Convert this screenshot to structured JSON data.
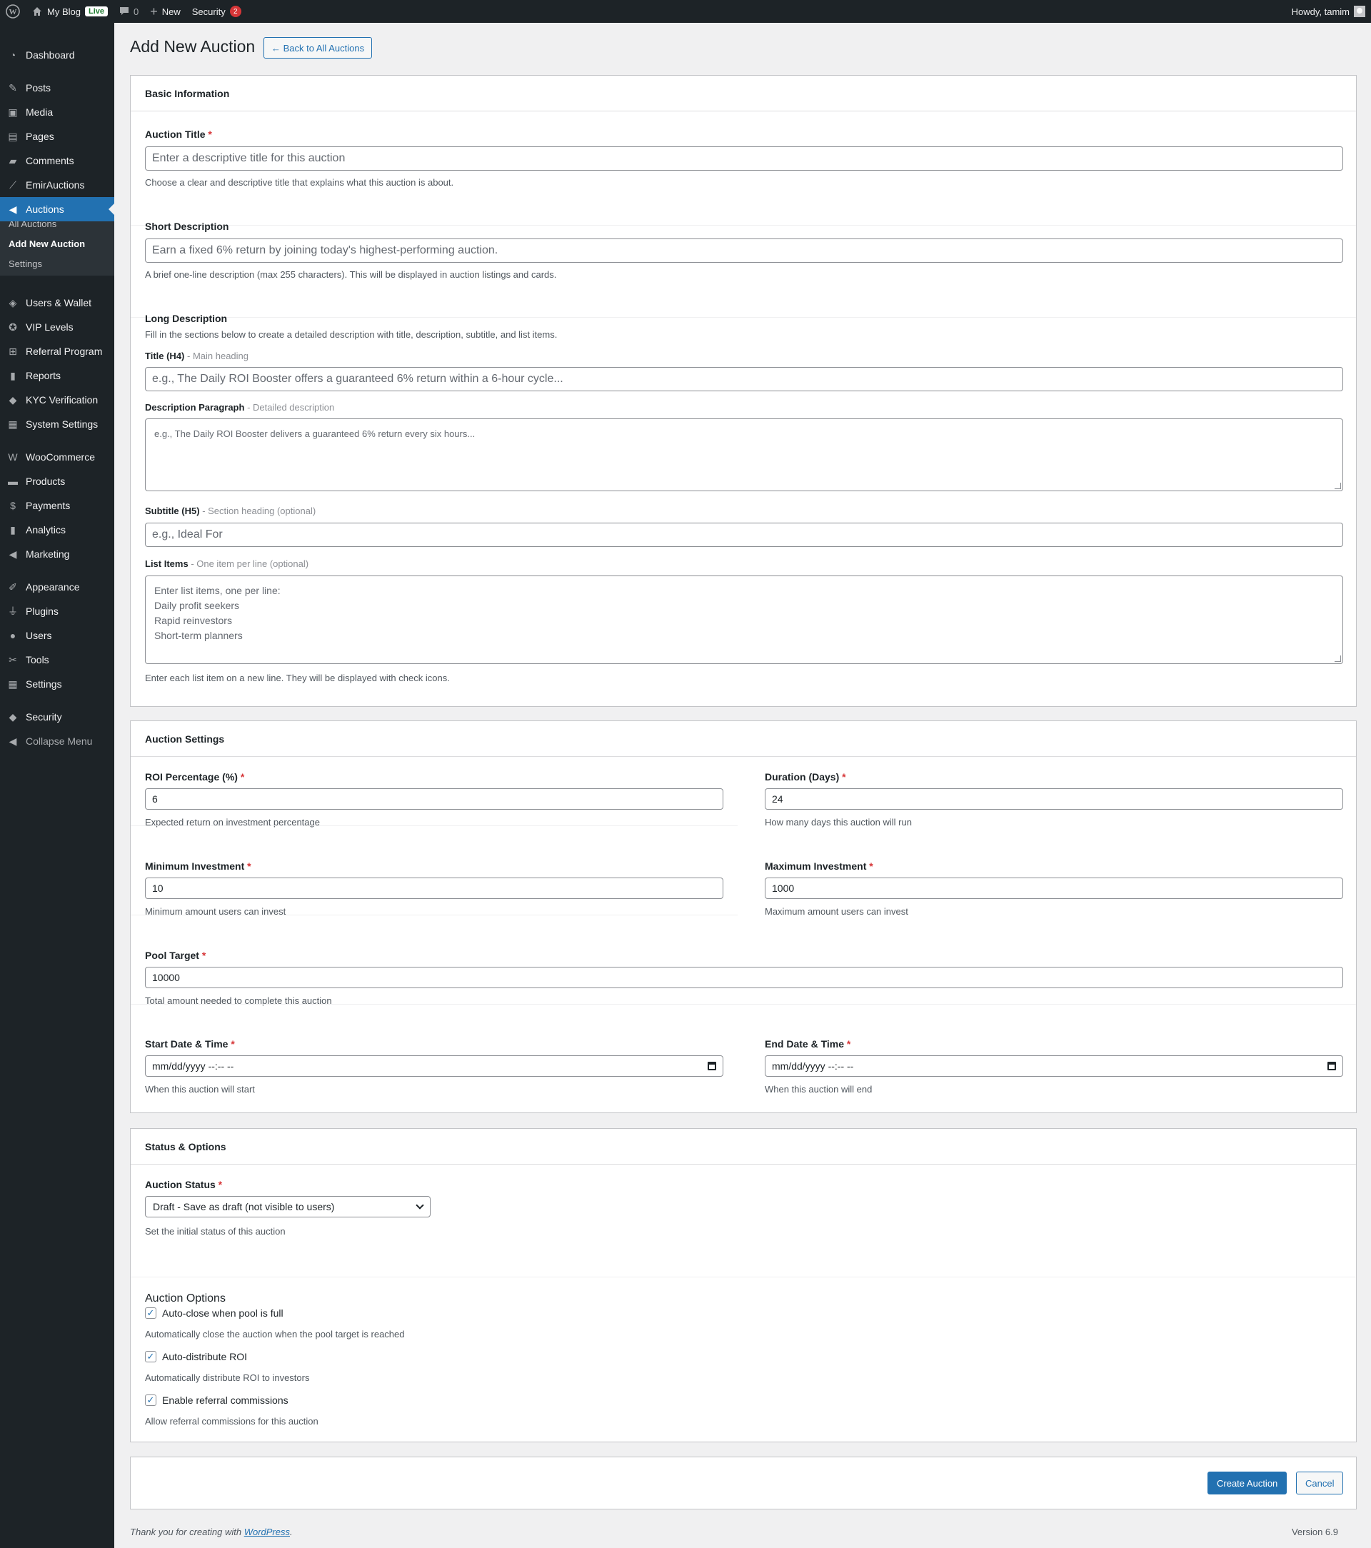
{
  "adminbar": {
    "site_name": "My Blog",
    "live_badge": "Live",
    "comments_count": "0",
    "new_label": "New",
    "security_label": "Security",
    "security_count": "2",
    "howdy": "Howdy, tamim"
  },
  "sidebar": {
    "items": [
      {
        "label": "Dashboard",
        "icon": "dashboard-icon"
      },
      {
        "label": "Posts",
        "icon": "pin-icon"
      },
      {
        "label": "Media",
        "icon": "media-icon"
      },
      {
        "label": "Pages",
        "icon": "pages-icon"
      },
      {
        "label": "Comments",
        "icon": "comment-icon"
      },
      {
        "label": "EmirAuctions",
        "icon": "chart-line-icon"
      },
      {
        "label": "Auctions",
        "icon": "megaphone-icon"
      },
      {
        "label": "Users & Wallet",
        "icon": "wallet-icon"
      },
      {
        "label": "VIP Levels",
        "icon": "award-icon"
      },
      {
        "label": "Referral Program",
        "icon": "network-icon"
      },
      {
        "label": "Reports",
        "icon": "bar-chart-icon"
      },
      {
        "label": "KYC Verification",
        "icon": "shield-icon"
      },
      {
        "label": "System Settings",
        "icon": "settings-grid-icon"
      },
      {
        "label": "WooCommerce",
        "icon": "woo-icon"
      },
      {
        "label": "Products",
        "icon": "archive-icon"
      },
      {
        "label": "Payments",
        "icon": "dollar-icon"
      },
      {
        "label": "Analytics",
        "icon": "bar-chart-icon"
      },
      {
        "label": "Marketing",
        "icon": "megaphone-icon"
      },
      {
        "label": "Appearance",
        "icon": "brush-icon"
      },
      {
        "label": "Plugins",
        "icon": "plug-icon"
      },
      {
        "label": "Users",
        "icon": "user-icon"
      },
      {
        "label": "Tools",
        "icon": "wrench-icon"
      },
      {
        "label": "Settings",
        "icon": "settings-icon"
      },
      {
        "label": "Security",
        "icon": "shield-icon"
      },
      {
        "label": "Collapse Menu",
        "icon": "collapse-icon"
      }
    ],
    "submenu": [
      "All Auctions",
      "Add New Auction",
      "Settings"
    ]
  },
  "page": {
    "title": "Add New Auction",
    "back_button": "← Back to All Auctions"
  },
  "basic": {
    "header": "Basic Information",
    "title_label": "Auction Title",
    "title_placeholder": "Enter a descriptive title for this auction",
    "title_desc": "Choose a clear and descriptive title that explains what this auction is about.",
    "short_label": "Short Description",
    "short_value": "Earn a fixed 6% return by joining today's highest-performing auction.",
    "short_desc": "A brief one-line description (max 255 characters). This will be displayed in auction listings and cards.",
    "long_label": "Long Description",
    "long_desc": "Fill in the sections below to create a detailed description with title, description, subtitle, and list items.",
    "h4_label": "Title (H4)",
    "h4_hint": "- Main heading",
    "h4_placeholder": "e.g., The Daily ROI Booster offers a guaranteed 6% return within a 6-hour cycle...",
    "para_label": "Description Paragraph",
    "para_hint": "- Detailed description",
    "para_placeholder": "e.g., The Daily ROI Booster delivers a guaranteed 6% return every six hours...",
    "h5_label": "Subtitle (H5)",
    "h5_hint": "- Section heading (optional)",
    "h5_placeholder": "e.g., Ideal For",
    "list_label": "List Items",
    "list_hint": "- One item per line (optional)",
    "list_placeholder_lines": [
      "Enter list items, one per line:",
      "Daily profit seekers",
      "Rapid reinvestors",
      "Short-term planners"
    ],
    "list_desc": "Enter each list item on a new line. They will be displayed with check icons."
  },
  "settings": {
    "header": "Auction Settings",
    "roi_label": "ROI Percentage (%)",
    "roi_value": "6",
    "roi_desc": "Expected return on investment percentage",
    "duration_label": "Duration (Days)",
    "duration_value": "24",
    "duration_desc": "How many days this auction will run",
    "min_label": "Minimum Investment",
    "min_value": "10",
    "min_desc": "Minimum amount users can invest",
    "max_label": "Maximum Investment",
    "max_value": "1000",
    "max_desc": "Maximum amount users can invest",
    "pool_label": "Pool Target",
    "pool_value": "10000",
    "pool_desc": "Total amount needed to complete this auction",
    "start_label": "Start Date & Time",
    "start_value": "mm/dd/yyyy --:-- --",
    "start_desc": "When this auction will start",
    "end_label": "End Date & Time",
    "end_value": "mm/dd/yyyy --:-- --",
    "end_desc": "When this auction will end"
  },
  "status": {
    "header": "Status & Options",
    "status_label": "Auction Status",
    "status_value": "Draft - Save as draft (not visible to users)",
    "status_desc": "Set the initial status of this auction",
    "options_label": "Auction Options",
    "options": [
      {
        "label": "Auto-close when pool is full",
        "desc": "Automatically close the auction when the pool target is reached",
        "checked": true
      },
      {
        "label": "Auto-distribute ROI",
        "desc": "Automatically distribute ROI to investors",
        "checked": true
      },
      {
        "label": "Enable referral commissions",
        "desc": "Allow referral commissions for this auction",
        "checked": true
      }
    ]
  },
  "actions": {
    "create": "Create Auction",
    "cancel": "Cancel"
  },
  "footer": {
    "thanks": "Thank you for creating with",
    "link": "WordPress",
    "period": ".",
    "version": "Version 6.9"
  },
  "colors": {
    "admin_bg": "#1d2327",
    "accent": "#2271b1",
    "required": "#d63638",
    "page_bg": "#f0f0f1"
  }
}
